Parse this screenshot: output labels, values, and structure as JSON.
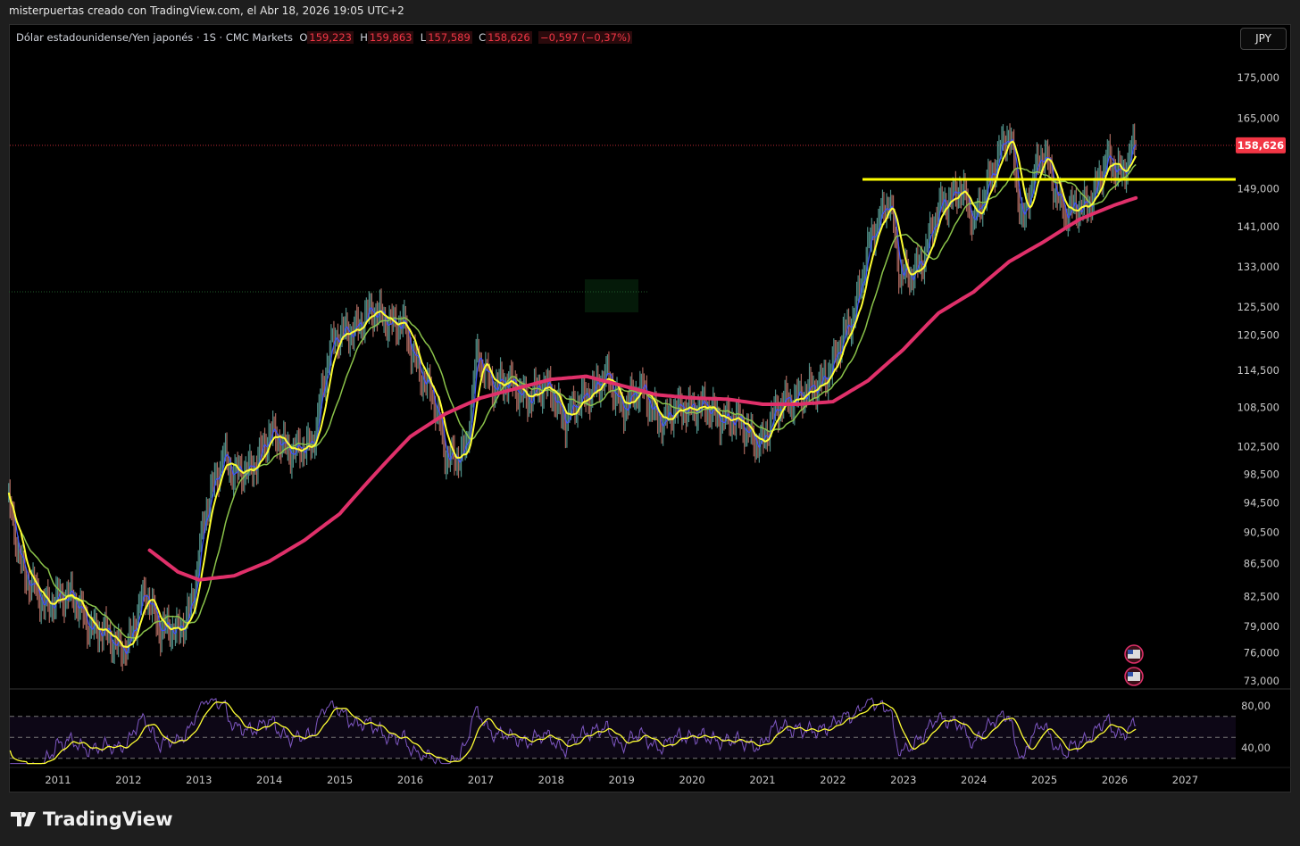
{
  "attribution": "misterpuertas creado con TradingView.com, el Abr 18, 2026 19:05 UTC+2",
  "legend": {
    "symbol": "Dólar estadounidense/Yen japonés · 1S · CMC Markets",
    "open_label": "O",
    "open": "159,223",
    "high_label": "H",
    "high": "159,863",
    "low_label": "L",
    "low": "157,589",
    "close_label": "C",
    "close": "158,626",
    "change": "−0,597 (−0,37%)"
  },
  "currency_button": "JPY",
  "logo_text": "TradingView",
  "colors": {
    "up": "#26a69a",
    "down": "#ef5350",
    "ma_fast": "#ffff33",
    "ma_mid": "#8bc34a",
    "ma_slow": "#e0306a",
    "ma_blue": "#3f51ff",
    "rsi": "#7e57c2",
    "hline": "#ffff00",
    "last_price": "#f23645"
  },
  "chart_data": {
    "type": "candlestick",
    "interval": "weekly",
    "scale": "log",
    "price_ticks": [
      "175,000",
      "165,000",
      "149,000",
      "141,000",
      "133,000",
      "125,500",
      "120,500",
      "114,500",
      "108,500",
      "102,500",
      "98,500",
      "94,500",
      "90,500",
      "86,500",
      "82,500",
      "79,000",
      "76,000",
      "73,000"
    ],
    "price_tick_values": [
      175000,
      165000,
      149000,
      141000,
      133000,
      125500,
      120500,
      114500,
      108500,
      102500,
      98500,
      94500,
      90500,
      86500,
      82500,
      79000,
      76000,
      73000
    ],
    "x_ticks": [
      "2011",
      "2012",
      "2013",
      "2014",
      "2015",
      "2016",
      "2017",
      "2018",
      "2019",
      "2020",
      "2021",
      "2022",
      "2023",
      "2024",
      "2025",
      "2026",
      "2027"
    ],
    "x_range": [
      2010.3,
      2027.6
    ],
    "y_range": [
      73000,
      175000
    ],
    "last_price": 158626,
    "last_price_label": "158,626",
    "horizontal_line": 151000,
    "close_keypoints": [
      [
        2010.3,
        94
      ],
      [
        2010.5,
        86
      ],
      [
        2010.8,
        81
      ],
      [
        2011.0,
        83
      ],
      [
        2011.2,
        82
      ],
      [
        2011.5,
        79
      ],
      [
        2011.8,
        77
      ],
      [
        2012.0,
        77
      ],
      [
        2012.25,
        83
      ],
      [
        2012.45,
        79
      ],
      [
        2012.7,
        78
      ],
      [
        2012.9,
        82
      ],
      [
        2013.1,
        93
      ],
      [
        2013.35,
        102
      ],
      [
        2013.5,
        98
      ],
      [
        2013.7,
        99
      ],
      [
        2014.0,
        104
      ],
      [
        2014.4,
        102
      ],
      [
        2014.6,
        102
      ],
      [
        2014.85,
        118
      ],
      [
        2015.0,
        120
      ],
      [
        2015.4,
        124
      ],
      [
        2015.6,
        124
      ],
      [
        2015.9,
        122
      ],
      [
        2016.0,
        118
      ],
      [
        2016.3,
        111
      ],
      [
        2016.5,
        101
      ],
      [
        2016.8,
        102
      ],
      [
        2016.95,
        117
      ],
      [
        2017.2,
        112
      ],
      [
        2017.5,
        112
      ],
      [
        2017.7,
        110
      ],
      [
        2018.0,
        112
      ],
      [
        2018.2,
        106
      ],
      [
        2018.5,
        111
      ],
      [
        2018.8,
        113
      ],
      [
        2019.0,
        109
      ],
      [
        2019.3,
        111
      ],
      [
        2019.6,
        106
      ],
      [
        2019.9,
        109
      ],
      [
        2020.2,
        108
      ],
      [
        2020.5,
        107
      ],
      [
        2020.9,
        104
      ],
      [
        2021.0,
        103
      ],
      [
        2021.3,
        110
      ],
      [
        2021.6,
        110
      ],
      [
        2021.9,
        114
      ],
      [
        2022.0,
        115
      ],
      [
        2022.3,
        125
      ],
      [
        2022.5,
        136
      ],
      [
        2022.8,
        148
      ],
      [
        2022.95,
        131
      ],
      [
        2023.1,
        131
      ],
      [
        2023.3,
        136
      ],
      [
        2023.5,
        144
      ],
      [
        2023.8,
        150
      ],
      [
        2024.0,
        141
      ],
      [
        2024.2,
        151
      ],
      [
        2024.5,
        161
      ],
      [
        2024.7,
        142
      ],
      [
        2024.8,
        149
      ],
      [
        2025.0,
        157
      ],
      [
        2025.3,
        143
      ],
      [
        2025.5,
        145
      ],
      [
        2025.7,
        148
      ],
      [
        2025.9,
        155
      ],
      [
        2026.1,
        153
      ],
      [
        2026.3,
        158.6
      ]
    ],
    "ma_slow_keypoints": [
      [
        2012.3,
        88.2
      ],
      [
        2012.7,
        85.5
      ],
      [
        2013.0,
        84.5
      ],
      [
        2013.5,
        85
      ],
      [
        2014.0,
        86.8
      ],
      [
        2014.5,
        89.5
      ],
      [
        2015.0,
        93
      ],
      [
        2015.5,
        98.5
      ],
      [
        2016.0,
        104
      ],
      [
        2016.5,
        107.5
      ],
      [
        2017.0,
        110
      ],
      [
        2017.5,
        111.5
      ],
      [
        2018.0,
        113
      ],
      [
        2018.5,
        113.5
      ],
      [
        2019.0,
        112
      ],
      [
        2019.5,
        110.5
      ],
      [
        2020.0,
        110
      ],
      [
        2020.5,
        109.8
      ],
      [
        2021.0,
        109
      ],
      [
        2021.5,
        109
      ],
      [
        2022.0,
        109.4
      ],
      [
        2022.5,
        112.8
      ],
      [
        2023.0,
        118
      ],
      [
        2023.5,
        124.4
      ],
      [
        2024.0,
        128.3
      ],
      [
        2024.5,
        134
      ],
      [
        2025.0,
        138
      ],
      [
        2025.5,
        142.5
      ],
      [
        2026.0,
        145.5
      ],
      [
        2026.3,
        147
      ]
    ],
    "rsi": {
      "ticks": [
        "80,00",
        "40,00"
      ],
      "tick_values": [
        80,
        40
      ],
      "bands": [
        70,
        50,
        30
      ],
      "range": [
        20,
        90
      ]
    }
  }
}
